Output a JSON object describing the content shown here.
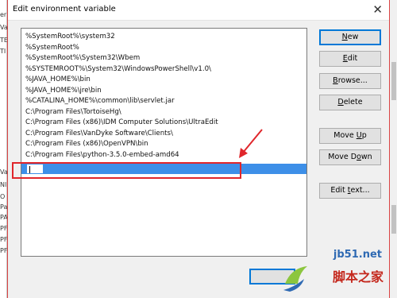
{
  "dialog": {
    "title": "Edit environment variable",
    "close_glyph": "✕"
  },
  "background_fragments": [
    "er",
    "Va",
    "TE",
    "TI",
    "Va",
    "Nl",
    "O",
    "Pa",
    "PA",
    "PF",
    "PF",
    "PF"
  ],
  "list": {
    "items": [
      "%SystemRoot%\\system32",
      "%SystemRoot%",
      "%SystemRoot%\\System32\\Wbem",
      "%SYSTEMROOT%\\System32\\WindowsPowerShell\\v1.0\\",
      "%JAVA_HOME%\\bin",
      "%JAVA_HOME%\\jre\\bin",
      "%CATALINA_HOME%\\common\\lib\\servlet.jar",
      "C:\\Program Files\\TortoiseHg\\",
      "C:\\Program Files (x86)\\IDM Computer Solutions\\UltraEdit",
      "C:\\Program Files\\VanDyke Software\\Clients\\",
      "C:\\Program Files (x86)\\OpenVPN\\bin",
      "C:\\Program Files\\python-3.5.0-embed-amd64"
    ],
    "new_entry_value": ""
  },
  "buttons": {
    "new": {
      "pre": "",
      "u": "N",
      "post": "ew"
    },
    "edit": {
      "pre": "",
      "u": "E",
      "post": "dit"
    },
    "browse": {
      "pre": "",
      "u": "B",
      "post": "rowse..."
    },
    "delete": {
      "pre": "",
      "u": "D",
      "post": "elete"
    },
    "move_up": {
      "pre": "Move ",
      "u": "U",
      "post": "p"
    },
    "move_down": {
      "pre": "Move D",
      "u": "o",
      "post": "wn"
    },
    "edit_text": {
      "pre": "Edit ",
      "u": "t",
      "post": "ext..."
    }
  },
  "watermark": {
    "top": "jb51.net",
    "bottom": "脚本之家"
  },
  "colors": {
    "selection": "#3d8fe8",
    "highlight_box": "#e0262b",
    "dialog_border": "#d94343",
    "primary_border": "#0078d7"
  }
}
